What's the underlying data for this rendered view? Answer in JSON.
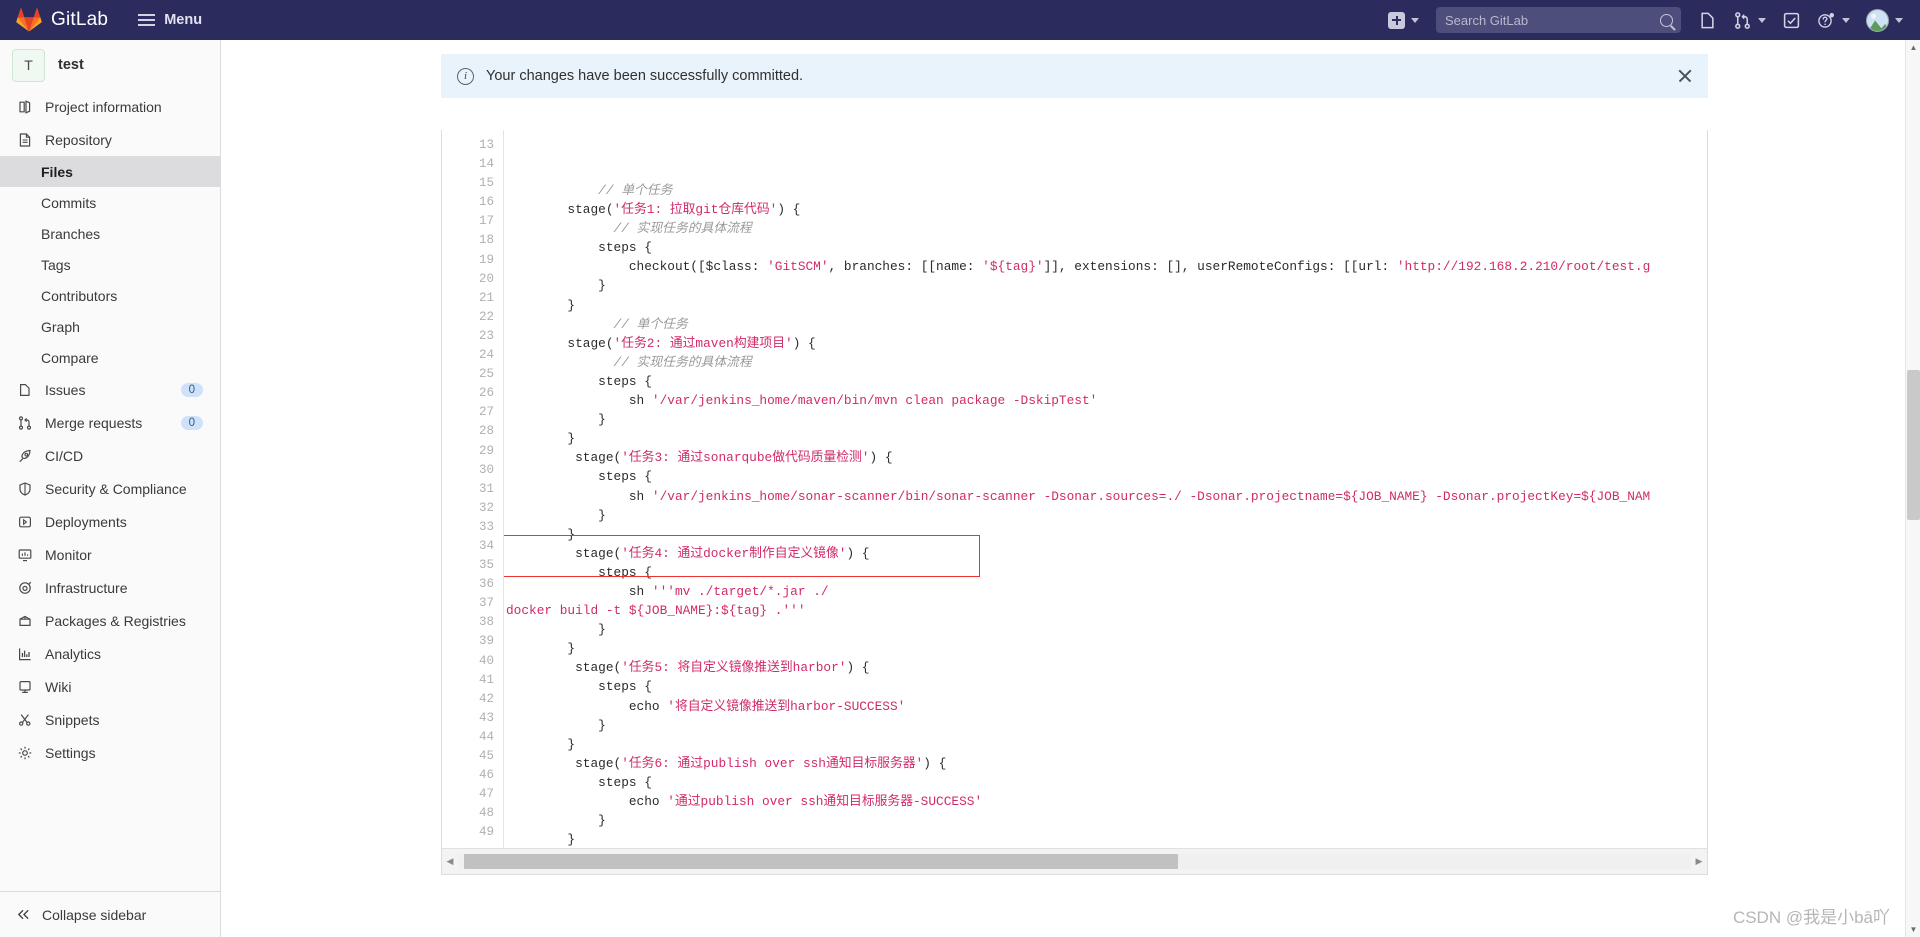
{
  "topbar": {
    "brand": "GitLab",
    "menu_label": "Menu",
    "new_icon": "plus-square-icon",
    "new_caret": "chevron-down-icon",
    "search_placeholder": "Search GitLab",
    "search_icon": "search-icon",
    "icons": [
      {
        "name": "issues-icon",
        "glyph": "issues"
      },
      {
        "name": "merge-requests-icon",
        "glyph": "merge"
      },
      {
        "name": "todos-icon",
        "glyph": "todo"
      },
      {
        "name": "help-icon",
        "glyph": "help"
      },
      {
        "name": "user-avatar",
        "glyph": "avatar"
      }
    ]
  },
  "sidebar": {
    "project_initial": "T",
    "project_name": "test",
    "items": [
      {
        "label": "Project information",
        "icon": "project-information-icon",
        "type": "top"
      },
      {
        "label": "Repository",
        "icon": "repository-icon",
        "type": "top"
      },
      {
        "label": "Files",
        "icon": "",
        "type": "sub",
        "active": true
      },
      {
        "label": "Commits",
        "icon": "",
        "type": "sub"
      },
      {
        "label": "Branches",
        "icon": "",
        "type": "sub"
      },
      {
        "label": "Tags",
        "icon": "",
        "type": "sub"
      },
      {
        "label": "Contributors",
        "icon": "",
        "type": "sub"
      },
      {
        "label": "Graph",
        "icon": "",
        "type": "sub"
      },
      {
        "label": "Compare",
        "icon": "",
        "type": "sub"
      },
      {
        "label": "Issues",
        "icon": "issues-icon",
        "type": "top",
        "badge": "0"
      },
      {
        "label": "Merge requests",
        "icon": "merge-requests-icon",
        "type": "top",
        "badge": "0"
      },
      {
        "label": "CI/CD",
        "icon": "rocket-icon",
        "type": "top"
      },
      {
        "label": "Security & Compliance",
        "icon": "shield-icon",
        "type": "top"
      },
      {
        "label": "Deployments",
        "icon": "deployments-icon",
        "type": "top"
      },
      {
        "label": "Monitor",
        "icon": "monitor-icon",
        "type": "top"
      },
      {
        "label": "Infrastructure",
        "icon": "infrastructure-icon",
        "type": "top"
      },
      {
        "label": "Packages & Registries",
        "icon": "package-icon",
        "type": "top"
      },
      {
        "label": "Analytics",
        "icon": "analytics-icon",
        "type": "top"
      },
      {
        "label": "Wiki",
        "icon": "wiki-icon",
        "type": "top"
      },
      {
        "label": "Snippets",
        "icon": "snippets-icon",
        "type": "top"
      },
      {
        "label": "Settings",
        "icon": "gear-icon",
        "type": "top"
      }
    ],
    "collapse_label": "Collapse sidebar",
    "collapse_icon": "chevron-double-left-icon"
  },
  "alert": {
    "icon": "info-icon",
    "text": "Your changes have been successfully committed.",
    "close_icon": "close-icon"
  },
  "code": {
    "first_line": 13,
    "last_line": 49,
    "lines": [
      {
        "n": 13,
        "segments": [
          {
            "t": "            ",
            "c": "kw"
          },
          {
            "t": "// 单个任务",
            "c": "cm"
          }
        ]
      },
      {
        "n": 14,
        "segments": [
          {
            "t": "        stage(",
            "c": "kw"
          },
          {
            "t": "'任务1: 拉取git仓库代码'",
            "c": "st"
          },
          {
            "t": ") {",
            "c": "kw"
          }
        ]
      },
      {
        "n": 15,
        "segments": [
          {
            "t": "              ",
            "c": "kw"
          },
          {
            "t": "// 实现任务的具体流程",
            "c": "cm"
          }
        ]
      },
      {
        "n": 16,
        "segments": [
          {
            "t": "            steps {",
            "c": "kw"
          }
        ]
      },
      {
        "n": 17,
        "segments": [
          {
            "t": "                checkout([$class: ",
            "c": "kw"
          },
          {
            "t": "'GitSCM'",
            "c": "st"
          },
          {
            "t": ", branches: [[name: ",
            "c": "kw"
          },
          {
            "t": "'${tag}'",
            "c": "st"
          },
          {
            "t": "]], extensions: [], userRemoteConfigs: [[url: ",
            "c": "kw"
          },
          {
            "t": "'http://192.168.2.210/root/test.g",
            "c": "st"
          }
        ]
      },
      {
        "n": 18,
        "segments": [
          {
            "t": "            }",
            "c": "kw"
          }
        ]
      },
      {
        "n": 19,
        "segments": [
          {
            "t": "        }",
            "c": "kw"
          }
        ]
      },
      {
        "n": 20,
        "segments": [
          {
            "t": "              ",
            "c": "kw"
          },
          {
            "t": "// 单个任务",
            "c": "cm"
          }
        ]
      },
      {
        "n": 21,
        "segments": [
          {
            "t": "        stage(",
            "c": "kw"
          },
          {
            "t": "'任务2: 通过maven构建项目'",
            "c": "st"
          },
          {
            "t": ") {",
            "c": "kw"
          }
        ]
      },
      {
        "n": 22,
        "segments": [
          {
            "t": "              ",
            "c": "kw"
          },
          {
            "t": "// 实现任务的具体流程",
            "c": "cm"
          }
        ]
      },
      {
        "n": 23,
        "segments": [
          {
            "t": "            steps {",
            "c": "kw"
          }
        ]
      },
      {
        "n": 24,
        "segments": [
          {
            "t": "                sh ",
            "c": "kw"
          },
          {
            "t": "'/var/jenkins_home/maven/bin/mvn clean package -DskipTest'",
            "c": "st"
          }
        ]
      },
      {
        "n": 25,
        "segments": [
          {
            "t": "            }",
            "c": "kw"
          }
        ]
      },
      {
        "n": 26,
        "segments": [
          {
            "t": "        }",
            "c": "kw"
          }
        ]
      },
      {
        "n": 27,
        "segments": [
          {
            "t": "         stage(",
            "c": "kw"
          },
          {
            "t": "'任务3: 通过sonarqube做代码质量检测'",
            "c": "st"
          },
          {
            "t": ") {",
            "c": "kw"
          }
        ]
      },
      {
        "n": 28,
        "segments": [
          {
            "t": "            steps {",
            "c": "kw"
          }
        ]
      },
      {
        "n": 29,
        "segments": [
          {
            "t": "                sh ",
            "c": "kw"
          },
          {
            "t": "'/var/jenkins_home/sonar-scanner/bin/sonar-scanner -Dsonar.sources=./ -Dsonar.projectname=${JOB_NAME} -Dsonar.projectKey=${JOB_NAM",
            "c": "st"
          }
        ]
      },
      {
        "n": 30,
        "segments": [
          {
            "t": "            }",
            "c": "kw"
          }
        ]
      },
      {
        "n": 31,
        "segments": [
          {
            "t": "        }",
            "c": "kw"
          }
        ]
      },
      {
        "n": 32,
        "segments": [
          {
            "t": "         stage(",
            "c": "kw"
          },
          {
            "t": "'任务4: 通过docker制作自定义镜像'",
            "c": "st"
          },
          {
            "t": ") {",
            "c": "kw"
          }
        ]
      },
      {
        "n": 33,
        "segments": [
          {
            "t": "            steps {",
            "c": "kw"
          }
        ]
      },
      {
        "n": 34,
        "segments": [
          {
            "t": "                sh ",
            "c": "kw"
          },
          {
            "t": "'''mv ./target/*.jar ./",
            "c": "st"
          }
        ]
      },
      {
        "n": 35,
        "segments": [
          {
            "t": "docker build -t ${JOB_NAME}:${tag} .'''",
            "c": "st"
          }
        ]
      },
      {
        "n": 36,
        "segments": [
          {
            "t": "            }",
            "c": "kw"
          }
        ]
      },
      {
        "n": 37,
        "segments": [
          {
            "t": "        }",
            "c": "kw"
          }
        ]
      },
      {
        "n": 38,
        "segments": [
          {
            "t": "         stage(",
            "c": "kw"
          },
          {
            "t": "'任务5: 将自定义镜像推送到harbor'",
            "c": "st"
          },
          {
            "t": ") {",
            "c": "kw"
          }
        ]
      },
      {
        "n": 39,
        "segments": [
          {
            "t": "            steps {",
            "c": "kw"
          }
        ]
      },
      {
        "n": 40,
        "segments": [
          {
            "t": "                echo ",
            "c": "kw"
          },
          {
            "t": "'将自定义镜像推送到harbor-SUCCESS'",
            "c": "st"
          }
        ]
      },
      {
        "n": 41,
        "segments": [
          {
            "t": "            }",
            "c": "kw"
          }
        ]
      },
      {
        "n": 42,
        "segments": [
          {
            "t": "        }",
            "c": "kw"
          }
        ]
      },
      {
        "n": 43,
        "segments": [
          {
            "t": "         stage(",
            "c": "kw"
          },
          {
            "t": "'任务6: 通过publish over ssh通知目标服务器'",
            "c": "st"
          },
          {
            "t": ") {",
            "c": "kw"
          }
        ]
      },
      {
        "n": 44,
        "segments": [
          {
            "t": "            steps {",
            "c": "kw"
          }
        ]
      },
      {
        "n": 45,
        "segments": [
          {
            "t": "                echo ",
            "c": "kw"
          },
          {
            "t": "'通过publish over ssh通知目标服务器-SUCCESS'",
            "c": "st"
          }
        ]
      },
      {
        "n": 46,
        "segments": [
          {
            "t": "            }",
            "c": "kw"
          }
        ]
      },
      {
        "n": 47,
        "segments": [
          {
            "t": "        }",
            "c": "kw"
          }
        ]
      },
      {
        "n": 48,
        "segments": [
          {
            "t": "    }",
            "c": "kw"
          }
        ]
      },
      {
        "n": 49,
        "segments": [
          {
            "t": "}",
            "c": "kw"
          }
        ]
      }
    ],
    "highlight": {
      "from_line": 34,
      "to_line": 35,
      "color": "#ee3333"
    }
  },
  "scrollbars": {
    "h_left_arrow": "chevron-left-icon",
    "h_right_arrow": "chevron-right-icon",
    "v_up_arrow": "chevron-up-icon",
    "v_down_arrow": "chevron-down-icon"
  },
  "watermark": "CSDN @我是小bā吖",
  "float_logo": "hummingbird-logo",
  "colors": {
    "topbar": "#2b2b5e",
    "sidebar": "#fafafa",
    "active_sidebar": "#dcdcde",
    "alert_bg": "#e9f3fb",
    "string": "#d12a6a",
    "comment": "#999999",
    "highlight": "#ee3333",
    "badge": "#cfe2fb"
  }
}
